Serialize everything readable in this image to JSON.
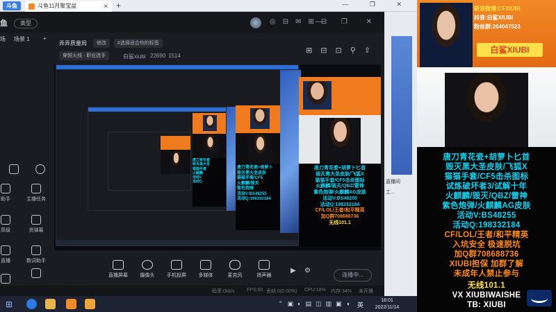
{
  "browser": {
    "logo_text": "斗鱼",
    "tab_title": "斗鱼11月聚宝盆",
    "new_tab": "+",
    "controls": "— ❐ ✕"
  },
  "app": {
    "logo": "鱼",
    "type_label": "类型",
    "scene_left": "场",
    "scene_label": "场景 1",
    "scene_add": "+",
    "stream_title": "弄弄质量局",
    "edit_label": "修改",
    "tag_hint": "#选择适合你的标签",
    "category": "穿越火线 · 职业选手",
    "host_name": "白鲨xiubi",
    "followers": "22690",
    "hot": "1514",
    "left_panel": [
      {
        "label": "",
        "icon": "circle-icon"
      },
      {
        "label": "",
        "icon": "copy-icon"
      },
      {
        "label": "助手",
        "icon": "bot-icon"
      },
      {
        "label": "主播任务",
        "icon": "task-icon"
      },
      {
        "label": "高级",
        "icon": "up-icon"
      },
      {
        "label": "资弹幕",
        "icon": "danmaku-icon"
      },
      {
        "label": "直播",
        "icon": "live-icon"
      },
      {
        "label": "数词助手",
        "icon": "helper-icon"
      },
      {
        "label": "教程",
        "icon": "tutorial-icon"
      },
      {
        "label": "",
        "icon": "box-icon"
      }
    ],
    "bottom_tools": [
      {
        "label": "直播屏幕",
        "icon": "screen-icon"
      },
      {
        "label": "摄像头",
        "icon": "camera-icon"
      },
      {
        "label": "手机投屏",
        "icon": "phone-icon"
      },
      {
        "label": "多媒体",
        "icon": "media-icon"
      },
      {
        "label": "麦克风",
        "icon": "mic-icon"
      },
      {
        "label": "扬声器",
        "icon": "speaker-icon"
      }
    ],
    "start_button": "连播中...",
    "status": {
      "bitrate": "码率:0kb/s",
      "fps": "FPS:60",
      "drop": "丢帧:0(0.00%)",
      "cpu": "CPU:18%",
      "mem": "内存:34%",
      "perf": "未开播"
    }
  },
  "middle_strip": {
    "lines": [
      "直播间",
      "工..."
    ]
  },
  "taskbar": {
    "ime": "英",
    "time": "18:01",
    "date": "2022/11/14"
  },
  "overlay": {
    "weibo": "新浪微博:CFXIUBI",
    "douyin": "抖音:白鲨XIUBI",
    "fans": "粉丝群:264047523",
    "name_plate": "白鲨XIUBI",
    "promo_lines": [
      "唐刀青花瓷+胡萝卜匕首",
      "毁灭黑大圣皮肤/飞狐X",
      "猫猫手套/CF5击杀图标",
      "试炼破坏者3/试解十年",
      "火麒麟/毁灭/QBZ/雷神",
      "紫色炮弹/火麒麟AG皮肤",
      "活动V:BS48255",
      "活动Q:198332184"
    ],
    "orange_lines": [
      "CF/LOL/王者/和平精英",
      "入坑安全   极速脱坑",
      "加Q群708688736",
      "XIUBI担保   加群了解",
      "未成年人禁止参与"
    ],
    "yellow_line": "无线101.1",
    "contact_line": "VX XIUBIWAISHE",
    "tb_line": "TB: XIUBI"
  },
  "colors": {
    "accent_orange": "#f07a1e",
    "promo_cyan": "#14d4f0",
    "brand_yellow": "#ffe04a",
    "app_bg": "#1b1c21"
  }
}
